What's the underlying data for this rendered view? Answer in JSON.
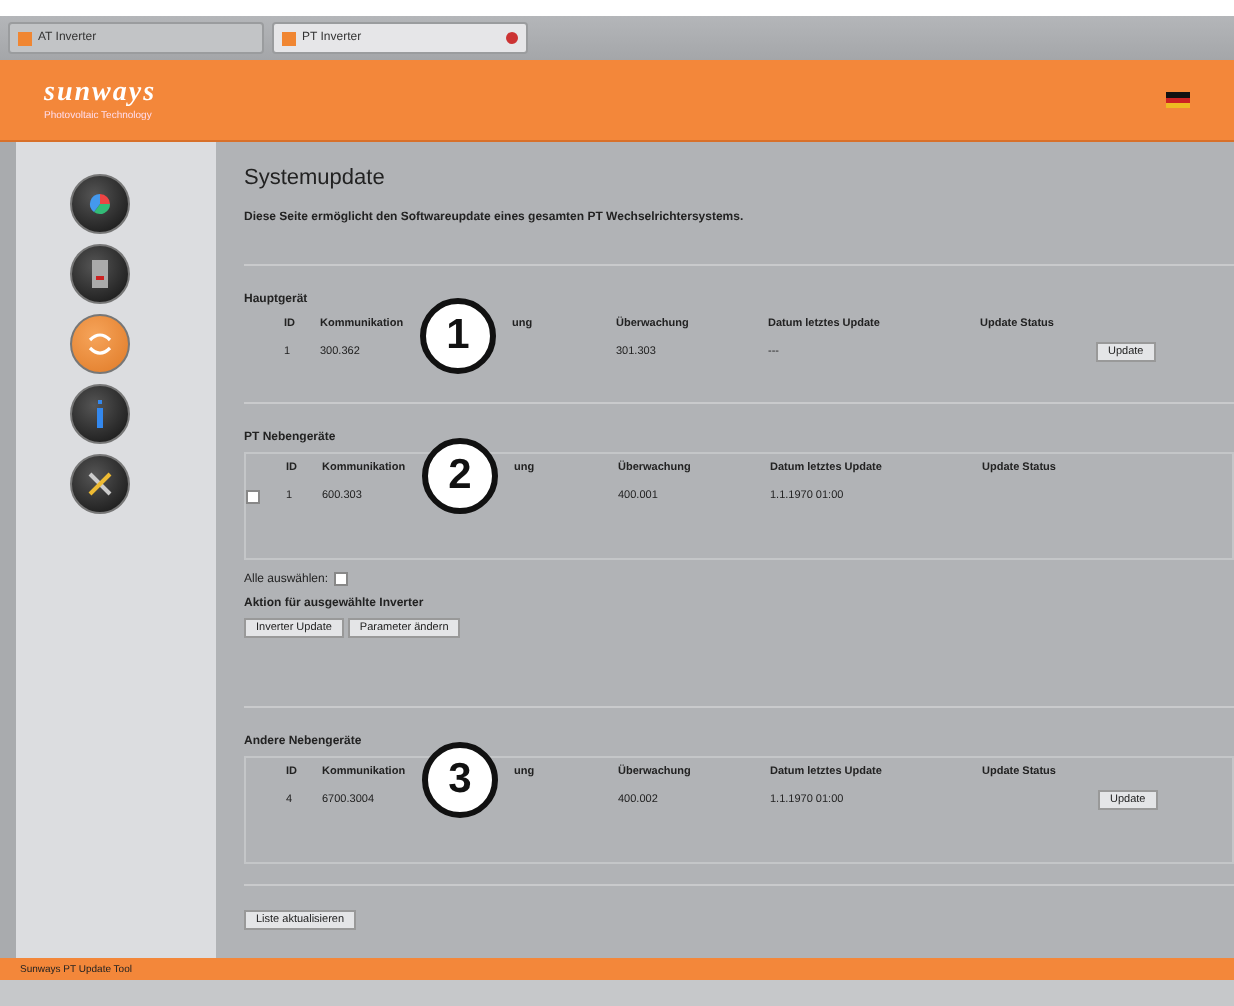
{
  "browser_tabs": [
    {
      "label": "AT Inverter",
      "selected": false
    },
    {
      "label": "PT Inverter",
      "selected": true
    }
  ],
  "header": {
    "logo": "sunways",
    "tagline": "Photovoltaic Technology"
  },
  "nav": [
    {
      "kind": "chart",
      "selected": false
    },
    {
      "kind": "device",
      "selected": false
    },
    {
      "kind": "update",
      "selected": true
    },
    {
      "kind": "info",
      "selected": false
    },
    {
      "kind": "tools",
      "selected": false
    }
  ],
  "page": {
    "title": "Systemupdate",
    "description": "Diese Seite ermöglicht den Softwareupdate eines gesamten PT Wechselrichtersystems."
  },
  "sections": [
    {
      "kind": "plain",
      "title": "Hauptgerät",
      "callout": "1",
      "columns": [
        "ID",
        "Kommunikation",
        "ung",
        "Überwachung",
        "Datum letztes Update",
        "Update Status"
      ],
      "rows": [
        {
          "cells": [
            "1",
            "300.362",
            "",
            "301.303",
            "---",
            ""
          ],
          "action": "Update"
        }
      ]
    },
    {
      "kind": "boxed",
      "title": "PT Nebengeräte",
      "callout": "2",
      "columns": [
        "ID",
        "Kommunikation",
        "ung",
        "Überwachung",
        "Datum letztes Update",
        "Update Status"
      ],
      "rows": [
        {
          "checked": false,
          "cells": [
            "1",
            "600.303",
            "",
            "400.001",
            "1.1.1970 01:00",
            ""
          ]
        }
      ],
      "select_all": {
        "label": "Alle auswählen:",
        "checked": false
      },
      "actions_label": "Aktion für ausgewählte Inverter",
      "actions": [
        "Inverter Update",
        "Parameter ändern"
      ]
    },
    {
      "kind": "boxed",
      "title": "Andere Nebengeräte",
      "callout": "3",
      "columns": [
        "ID",
        "Kommunikation",
        "ung",
        "Überwachung",
        "Datum letztes Update",
        "Update Status"
      ],
      "rows": [
        {
          "cells": [
            "4",
            "6700.3004",
            "",
            "400.002",
            "1.1.1970 01:00",
            ""
          ],
          "action": "Update"
        }
      ]
    }
  ],
  "refresh_button": "Liste aktualisieren",
  "footer": "Sunways PT Update Tool"
}
